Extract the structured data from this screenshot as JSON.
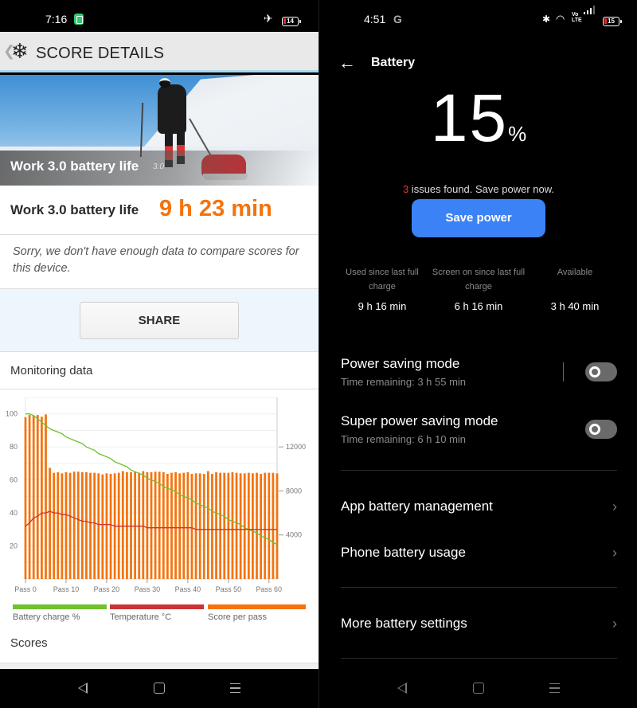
{
  "left": {
    "status_bar": {
      "time": "7:16",
      "battery_level": "14",
      "notification_icon": "battery-saver-icon",
      "airplane_icon": "airplane-icon"
    },
    "header": {
      "back_glyph": "❮",
      "logo_icon": "snowflake-icon",
      "logo_glyph": "❄",
      "title": "SCORE DETAILS"
    },
    "hero": {
      "title": "Work 3.0 battery life",
      "version": "3.0"
    },
    "score": {
      "label": "Work 3.0 battery life",
      "value": "9 h 23 min"
    },
    "notice": "Sorry, we don't have enough data to compare scores for this device.",
    "share_label": "SHARE",
    "monitoring_title": "Monitoring data",
    "scores_title": "Scores",
    "legend": [
      {
        "label": "Battery charge %",
        "color": "#6fc22a"
      },
      {
        "label": "Temperature °C",
        "color": "#cc3333"
      },
      {
        "label": "Score per pass",
        "color": "#f5730c"
      }
    ]
  },
  "right": {
    "status_bar": {
      "time": "4:51",
      "g_icon": "G",
      "battery_level": "15"
    },
    "header": {
      "back_glyph": "←",
      "title": "Battery"
    },
    "battery_percent": "15",
    "percent_sign": "%",
    "issues": {
      "count": "3",
      "text": " issues found. Save power now."
    },
    "save_power_label": "Save power",
    "stats": [
      {
        "label": "Used since last full charge",
        "value": "9 h 16 min"
      },
      {
        "label": "Screen on since last full charge",
        "value": "6 h 16 min"
      },
      {
        "label": "Available",
        "value": "3 h 40 min"
      }
    ],
    "modes": [
      {
        "name": "Power saving mode",
        "sub": "Time remaining:  3 h 55 min",
        "enabled": false
      },
      {
        "name": "Super power saving mode",
        "sub": "Time remaining:  6 h 10 min",
        "enabled": false
      }
    ],
    "links": [
      {
        "label": "App battery management"
      },
      {
        "label": "Phone battery usage"
      },
      {
        "label": "More battery settings"
      }
    ],
    "chevron_glyph": "›"
  },
  "chart_data": {
    "type": "bar",
    "title": "Monitoring data",
    "x_tick_labels": [
      "Pass 0",
      "Pass 10",
      "Pass 20",
      "Pass 30",
      "Pass 40",
      "Pass 50",
      "Pass 60"
    ],
    "x_range": [
      0,
      62
    ],
    "y_left": {
      "ticks": [
        20,
        40,
        60,
        80,
        100
      ],
      "range": [
        0,
        110
      ]
    },
    "y_right": {
      "ticks": [
        4000,
        8000,
        12000
      ],
      "range": [
        0,
        16500
      ]
    },
    "grid": true,
    "legend_position": "bottom",
    "series": [
      {
        "name": "Score per pass",
        "type": "bar",
        "axis": "right",
        "color": "#f5730c",
        "values": [
          14700,
          14900,
          14850,
          14900,
          14750,
          14950,
          10100,
          9650,
          9700,
          9600,
          9700,
          9650,
          9750,
          9750,
          9700,
          9700,
          9650,
          9650,
          9600,
          9500,
          9600,
          9550,
          9600,
          9650,
          9800,
          9700,
          9700,
          9750,
          9650,
          9800,
          9700,
          9700,
          9750,
          9750,
          9700,
          9550,
          9650,
          9700,
          9600,
          9650,
          9700,
          9550,
          9600,
          9600,
          9550,
          9800,
          9550,
          9700,
          9650,
          9650,
          9650,
          9700,
          9650,
          9600,
          9600,
          9650,
          9600,
          9650,
          9550,
          9650,
          9650,
          9650,
          9600
        ]
      },
      {
        "name": "Battery charge %",
        "type": "line",
        "axis": "left",
        "color": "#6fc22a",
        "values": [
          100,
          100,
          99,
          97,
          95,
          93,
          91,
          90,
          89,
          88,
          86,
          85,
          84,
          83,
          82,
          80,
          79,
          78,
          76,
          75,
          74,
          73,
          71,
          70,
          69,
          68,
          66,
          65,
          64,
          63,
          61,
          60,
          59,
          58,
          56,
          55,
          54,
          53,
          51,
          50,
          49,
          48,
          46,
          45,
          44,
          43,
          41,
          40,
          39,
          38,
          36,
          35,
          34,
          33,
          31,
          30,
          29,
          28,
          26,
          25,
          24,
          22,
          21
        ]
      },
      {
        "name": "Temperature °C",
        "type": "line",
        "axis": "left",
        "color": "#cc3333",
        "values": [
          32,
          34,
          37,
          38,
          40,
          40,
          41,
          40,
          40,
          39,
          39,
          38,
          37,
          36,
          35,
          35,
          34,
          34,
          33,
          33,
          33,
          33,
          32,
          32,
          32,
          32,
          32,
          32,
          32,
          32,
          31,
          31,
          31,
          31,
          31,
          31,
          31,
          31,
          31,
          31,
          31,
          31,
          30,
          30,
          30,
          30,
          30,
          30,
          30,
          30,
          30,
          30,
          30,
          30,
          30,
          30,
          30,
          30,
          30,
          30,
          30,
          30,
          30
        ]
      }
    ]
  }
}
